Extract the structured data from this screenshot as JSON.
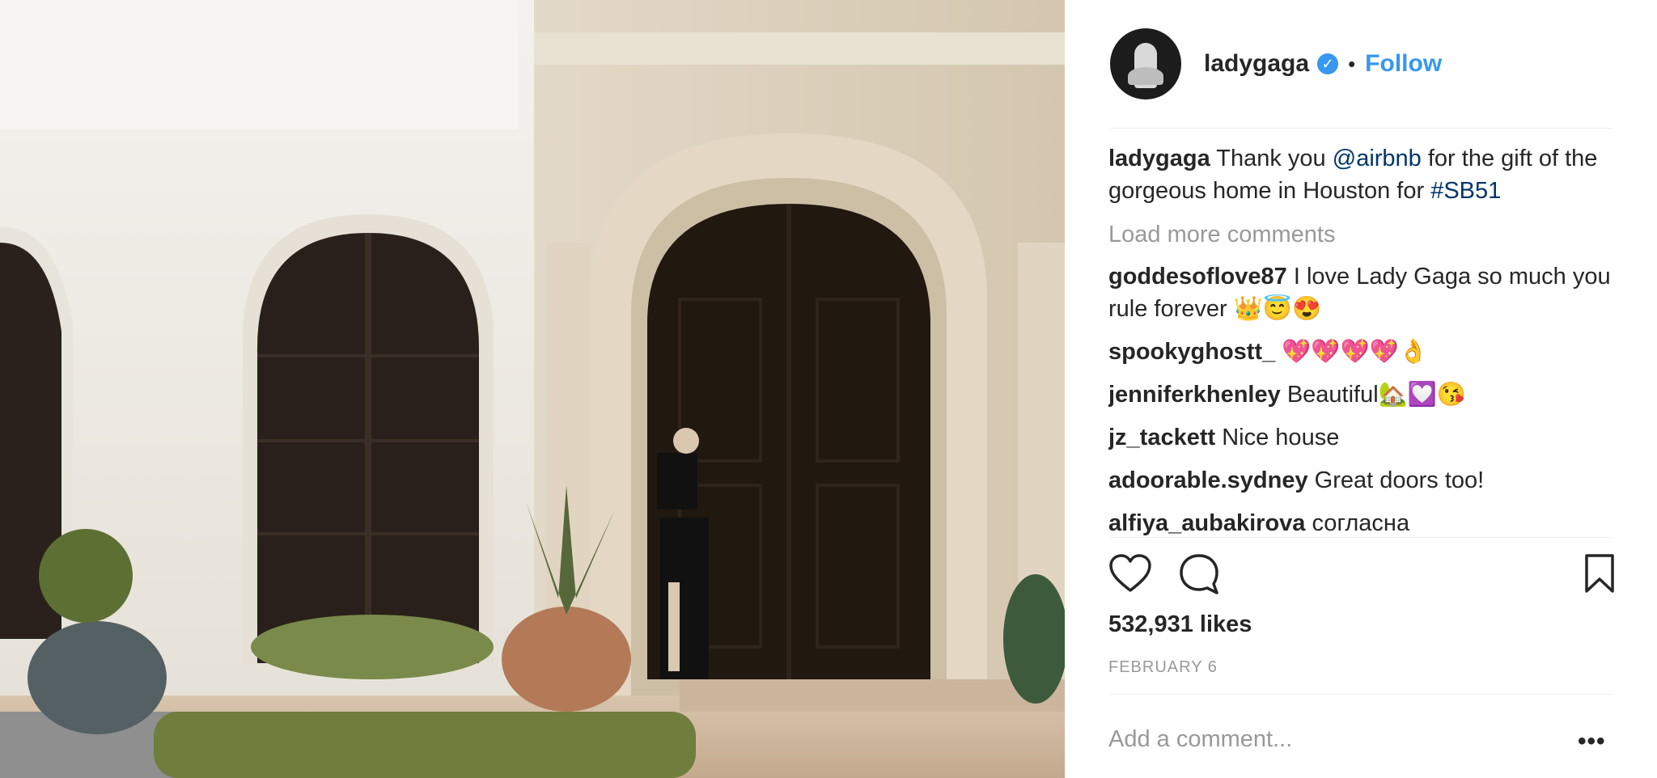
{
  "post": {
    "username": "ladygaga",
    "verified_icon": "verified-badge-icon",
    "dot": "•",
    "follow_label": "Follow",
    "caption": {
      "user": "ladygaga",
      "text_before": "Thank you ",
      "mention": "@airbnb",
      "text_middle": " for the gift of the gorgeous home in Houston for ",
      "hashtag": "#SB51"
    },
    "load_more": "Load more comments",
    "comments": [
      {
        "user": "goddesoflove87",
        "text": "I love Lady Gaga so much you rule forever 👑😇😍"
      },
      {
        "user": "spookyghostt_",
        "text": "💖💖💖💖👌"
      },
      {
        "user": "jenniferkhenley",
        "text": "Beautiful🏡💟😘"
      },
      {
        "user": "jz_tackett",
        "text": "Nice house"
      },
      {
        "user": "adoorable.sydney",
        "text": "Great doors too!"
      },
      {
        "user": "alfiya_aubakirova",
        "text": "согласна"
      }
    ],
    "likes": "532,931 likes",
    "date": "FEBRUARY 6",
    "add_comment_placeholder": "Add a comment...",
    "more_label": "•••",
    "icons": {
      "like": "heart-icon",
      "comment": "comment-icon",
      "save": "bookmark-icon"
    },
    "colors": {
      "link_blue": "#3897f0",
      "mention_blue": "#003569",
      "muted": "#999999"
    }
  }
}
